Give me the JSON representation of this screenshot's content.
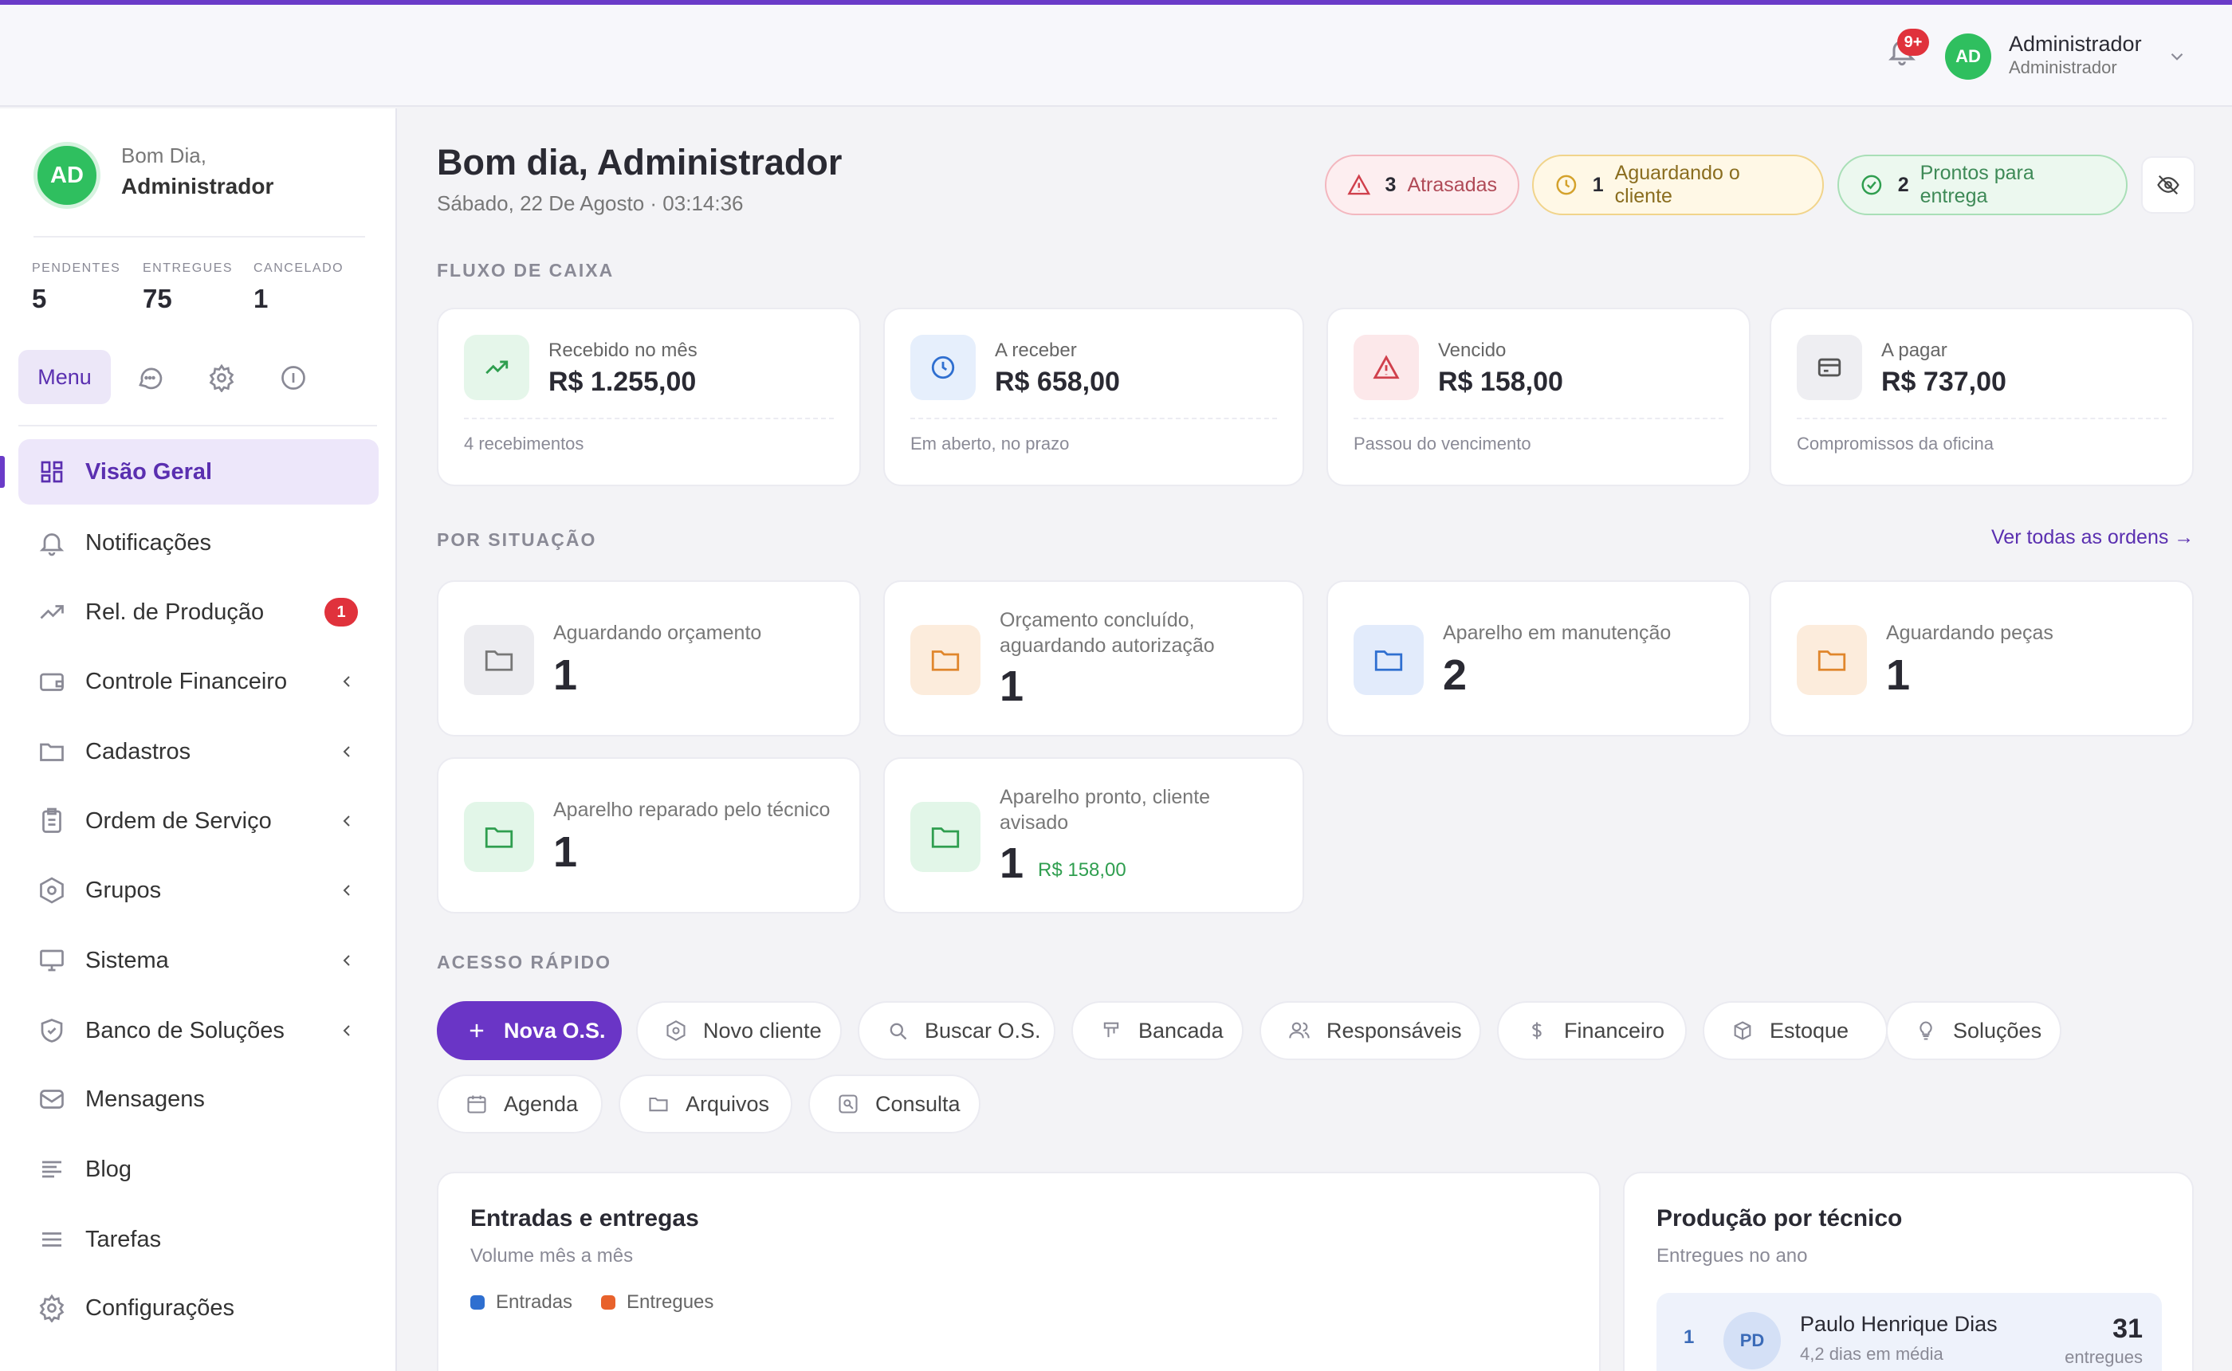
{
  "header": {
    "notif_badge": "9+",
    "user_initials": "AD",
    "user_name": "Administrador",
    "user_role": "Administrador"
  },
  "sidebar": {
    "avatar_initials": "AD",
    "greeting": "Bom Dia,",
    "user_name": "Administrador",
    "stats": [
      {
        "label": "PENDENTES",
        "value": "5"
      },
      {
        "label": "ENTREGUES",
        "value": "75"
      },
      {
        "label": "CANCELADO",
        "value": "1"
      }
    ],
    "menu_label": "Menu",
    "items": [
      {
        "label": "Visão Geral",
        "icon": "dashboard-icon"
      },
      {
        "label": "Notificações",
        "icon": "bell-icon"
      },
      {
        "label": "Rel. de Produção",
        "icon": "trending-icon",
        "badge": "1"
      },
      {
        "label": "Controle Financeiro",
        "icon": "wallet-icon"
      },
      {
        "label": "Cadastros",
        "icon": "folder-icon"
      },
      {
        "label": "Ordem de Serviço",
        "icon": "clipboard-icon"
      },
      {
        "label": "Grupos",
        "icon": "hexagon-icon"
      },
      {
        "label": "Sistema",
        "icon": "monitor-icon"
      },
      {
        "label": "Banco de Soluções",
        "icon": "shield-icon"
      },
      {
        "label": "Mensagens",
        "icon": "mail-icon"
      },
      {
        "label": "Blog",
        "icon": "text-icon"
      },
      {
        "label": "Tarefas",
        "icon": "list-icon"
      },
      {
        "label": "Configurações",
        "icon": "gear-icon"
      }
    ]
  },
  "main": {
    "title": "Bom dia, Administrador",
    "date": "Sábado, 22 De Agosto · 03:14:36",
    "pills": [
      {
        "count": "3",
        "label": "Atrasadas"
      },
      {
        "count": "1",
        "label": "Aguardando o cliente"
      },
      {
        "count": "2",
        "label": "Prontos para entrega"
      }
    ],
    "cash_title": "FLUXO DE CAIXA",
    "cash": [
      {
        "label": "Recebido no mês",
        "value": "R$ 1.255,00",
        "sub": "4 recebimentos"
      },
      {
        "label": "A receber",
        "value": "R$ 658,00",
        "sub": "Em aberto, no prazo"
      },
      {
        "label": "Vencido",
        "value": "R$ 158,00",
        "sub": "Passou do vencimento"
      },
      {
        "label": "A pagar",
        "value": "R$ 737,00",
        "sub": "Compromissos da oficina"
      }
    ],
    "status_title": "POR SITUAÇÃO",
    "status_link": "Ver todas as ordens →",
    "status": [
      {
        "label": "Aguardando orçamento",
        "value": "1"
      },
      {
        "label": "Orçamento concluído, aguardando autorização",
        "value": "1"
      },
      {
        "label": "Aparelho em manutenção",
        "value": "2"
      },
      {
        "label": "Aguardando peças",
        "value": "1"
      },
      {
        "label": "Aparelho reparado pelo técnico",
        "value": "1"
      },
      {
        "label": "Aparelho pronto, cliente avisado",
        "value": "1",
        "extra": "R$ 158,00"
      }
    ],
    "quick_title": "ACESSO RÁPIDO",
    "quick": [
      "Nova O.S.",
      "Novo cliente",
      "Buscar O.S.",
      "Bancada",
      "Responsáveis",
      "Financeiro",
      "Estoque",
      "Soluções",
      "Agenda",
      "Arquivos",
      "Consulta"
    ],
    "flow_card": {
      "title": "Entradas e entregas",
      "subtitle": "Volume mês a mês",
      "legend": [
        "Entradas",
        "Entregues"
      ]
    },
    "prod_card": {
      "title": "Produção por técnico",
      "subtitle": "Entregues no ano",
      "top": {
        "rank": "1",
        "initials": "PD",
        "name": "Paulo Henrique Dias",
        "sub": "4,2 dias em média",
        "count": "31",
        "count_label": "entregues"
      }
    }
  },
  "colors": {
    "accent": "#6a35c6",
    "success": "#2fbf5f",
    "danger": "#e0323c",
    "blue": "#2f6fd0",
    "orange": "#e8622c"
  }
}
